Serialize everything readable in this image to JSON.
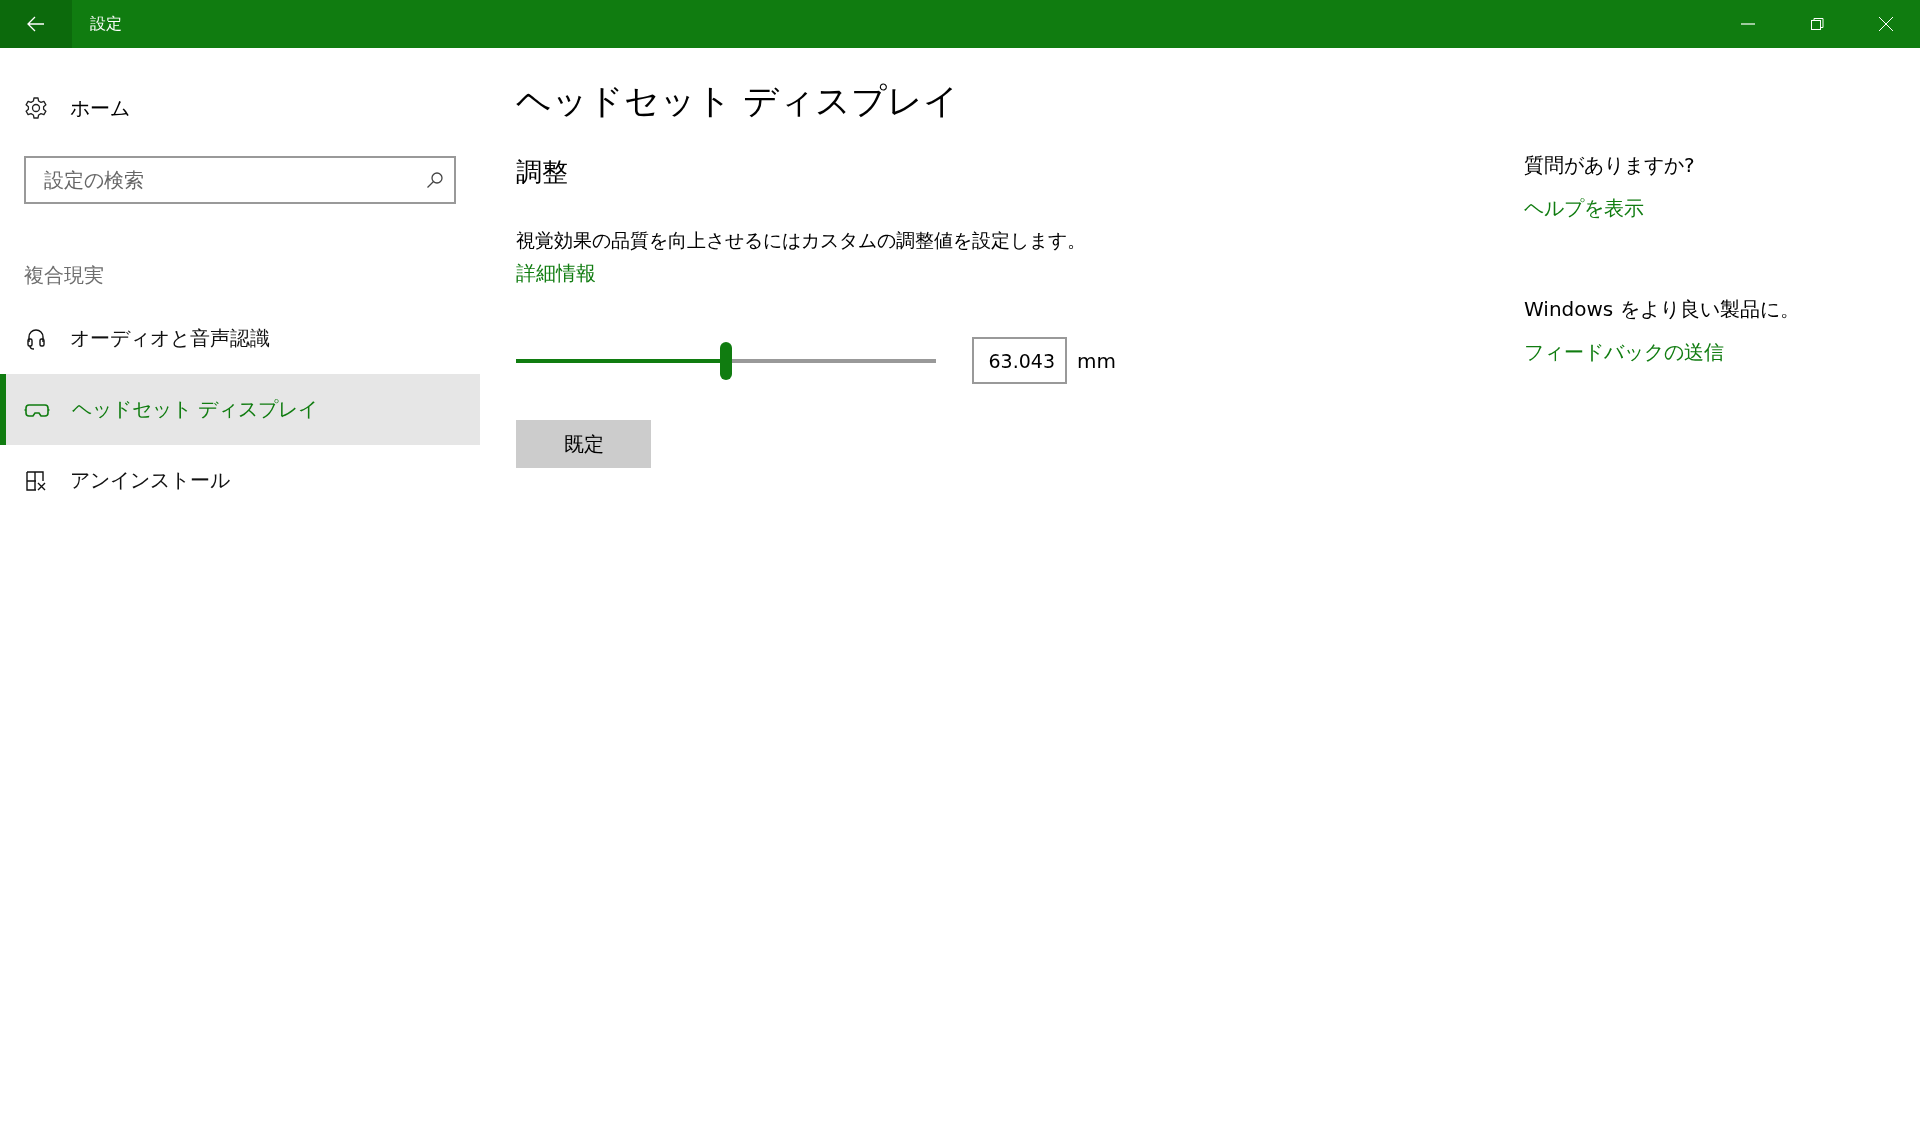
{
  "window": {
    "title": "設定"
  },
  "sidebar": {
    "home": "ホーム",
    "search": {
      "placeholder": "設定の検索"
    },
    "section": "複合現実",
    "items": [
      {
        "label": "オーディオと音声認識",
        "kind": "headphones",
        "selected": false
      },
      {
        "label": "ヘッドセット ディスプレイ",
        "kind": "headset",
        "selected": true
      },
      {
        "label": "アンインストール",
        "kind": "uninstall",
        "selected": false
      }
    ]
  },
  "page": {
    "title": "ヘッドセット ディスプレイ",
    "section": "調整",
    "description": "視覚効果の品質を向上させるにはカスタムの調整値を設定します。",
    "link": "詳細情報",
    "slider": {
      "level": 0.5
    },
    "value": "63.043",
    "unit": "mm",
    "button": "既定"
  },
  "aside": [
    {
      "heading": "質問がありますか?",
      "link": "ヘルプを表示"
    },
    {
      "heading": "Windows をより良い製品に。",
      "link": "フィードバックの送信"
    }
  ]
}
